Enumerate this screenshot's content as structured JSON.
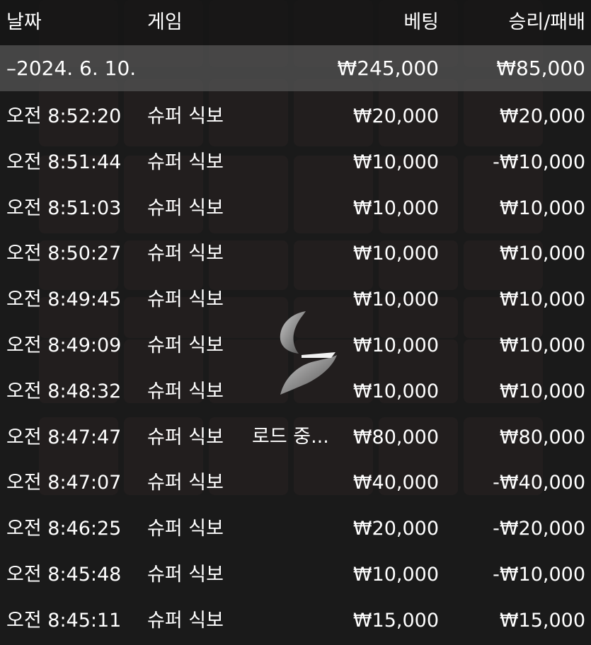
{
  "columns": {
    "date": "날짜",
    "game": "게임",
    "bet": "베팅",
    "win_loss": "승리/패배"
  },
  "summary": {
    "date": "–2024. 6. 10.",
    "bet": "₩245,000",
    "win_loss": "₩85,000"
  },
  "rows": [
    {
      "time": "오전 8:52:20",
      "game": "슈퍼 식보",
      "bet": "₩20,000",
      "win_loss": "₩20,000"
    },
    {
      "time": "오전 8:51:44",
      "game": "슈퍼 식보",
      "bet": "₩10,000",
      "win_loss": "-₩10,000"
    },
    {
      "time": "오전 8:51:03",
      "game": "슈퍼 식보",
      "bet": "₩10,000",
      "win_loss": "₩10,000"
    },
    {
      "time": "오전 8:50:27",
      "game": "슈퍼 식보",
      "bet": "₩10,000",
      "win_loss": "₩10,000"
    },
    {
      "time": "오전 8:49:45",
      "game": "슈퍼 식보",
      "bet": "₩10,000",
      "win_loss": "₩10,000"
    },
    {
      "time": "오전 8:49:09",
      "game": "슈퍼 식보",
      "bet": "₩10,000",
      "win_loss": "₩10,000"
    },
    {
      "time": "오전 8:48:32",
      "game": "슈퍼 식보",
      "bet": "₩10,000",
      "win_loss": "₩10,000"
    },
    {
      "time": "오전 8:47:47",
      "game": "슈퍼 식보",
      "bet": "₩80,000",
      "win_loss": "₩80,000"
    },
    {
      "time": "오전 8:47:07",
      "game": "슈퍼 식보",
      "bet": "₩40,000",
      "win_loss": "-₩40,000"
    },
    {
      "time": "오전 8:46:25",
      "game": "슈퍼 식보",
      "bet": "₩20,000",
      "win_loss": "-₩20,000"
    },
    {
      "time": "오전 8:45:48",
      "game": "슈퍼 식보",
      "bet": "₩10,000",
      "win_loss": "-₩10,000"
    },
    {
      "time": "오전 8:45:11",
      "game": "슈퍼 식보",
      "bet": "₩15,000",
      "win_loss": "₩15,000"
    }
  ],
  "loader": {
    "text": "로드 중...",
    "icon": "loading-spinner-icon"
  }
}
